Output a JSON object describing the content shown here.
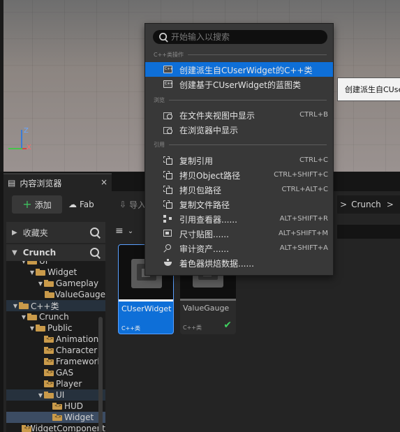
{
  "viewport": {
    "axis": {
      "x": "X",
      "y": "Y",
      "z": "Z"
    }
  },
  "content_browser": {
    "tab_title": "内容浏览器",
    "tab_close": "×",
    "toolbar": {
      "add_label": "添加",
      "fab_label": "Fab",
      "import_label": "导入"
    },
    "breadcrumb": {
      "current": "Crunch",
      "chevron": ">"
    },
    "favorites_label": "收藏夹",
    "root_label": "Crunch",
    "tree": [
      {
        "label": "UI",
        "depth": 2,
        "expanded": true,
        "code": false
      },
      {
        "label": "Widget",
        "depth": 3,
        "expanded": true,
        "code": false
      },
      {
        "label": "Gameplay",
        "depth": 4,
        "expanded": true,
        "code": false
      },
      {
        "label": "ValueGauge",
        "depth": 5,
        "expanded": false,
        "code": false
      },
      {
        "label": "C++类",
        "depth": 1,
        "expanded": true,
        "code": false
      },
      {
        "label": "Crunch",
        "depth": 2,
        "expanded": true,
        "code": false
      },
      {
        "label": "Public",
        "depth": 3,
        "expanded": true,
        "code": false
      },
      {
        "label": "Animation",
        "depth": 4,
        "expanded": false,
        "code": true
      },
      {
        "label": "Character",
        "depth": 4,
        "expanded": false,
        "code": true
      },
      {
        "label": "Framework",
        "depth": 4,
        "expanded": false,
        "code": true
      },
      {
        "label": "GAS",
        "depth": 4,
        "expanded": false,
        "code": true
      },
      {
        "label": "Player",
        "depth": 4,
        "expanded": false,
        "code": true
      },
      {
        "label": "UI",
        "depth": 4,
        "expanded": true,
        "code": false
      },
      {
        "label": "HUD",
        "depth": 5,
        "expanded": false,
        "code": true
      },
      {
        "label": "Widget",
        "depth": 5,
        "expanded": false,
        "code": true
      },
      {
        "label": "WidgetComponent",
        "depth": 5,
        "expanded": false,
        "code": true
      }
    ],
    "assets": [
      {
        "name": "CUserWidget",
        "kind": "C++类",
        "selected": true
      },
      {
        "name": "ValueGauge",
        "kind": "C++类",
        "selected": false
      }
    ]
  },
  "context_menu": {
    "search_placeholder": "开始输入以搜索",
    "sections": {
      "cpp": "C++类操作",
      "browse": "浏览",
      "reference": "引用"
    },
    "items": {
      "create_derived_cpp": {
        "label": "创建派生自CUserWidget的C++类",
        "shortcut": "",
        "icon": "cpp-class-icon"
      },
      "create_blueprint": {
        "label": "创建基于CUserWidget的蓝图类",
        "shortcut": "",
        "icon": "blueprint-class-icon"
      },
      "show_in_folder": {
        "label": "在文件夹视图中显示",
        "shortcut": "CTRL+B",
        "icon": "folder-search-icon"
      },
      "show_in_browser": {
        "label": "在浏览器中显示",
        "shortcut": "",
        "icon": "folder-search-icon"
      },
      "copy_reference": {
        "label": "复制引用",
        "shortcut": "CTRL+C",
        "icon": "copy-icon"
      },
      "copy_object_path": {
        "label": "拷贝Object路径",
        "shortcut": "CTRL+SHIFT+C",
        "icon": "copy-icon"
      },
      "copy_package_path": {
        "label": "拷贝包路径",
        "shortcut": "CTRL+ALT+C",
        "icon": "copy-icon"
      },
      "copy_file_path": {
        "label": "复制文件路径",
        "shortcut": "",
        "icon": "copy-icon"
      },
      "reference_viewer": {
        "label": "引用查看器......",
        "shortcut": "ALT+SHIFT+R",
        "icon": "reference-viewer-icon"
      },
      "size_map": {
        "label": "尺寸贴图......",
        "shortcut": "ALT+SHIFT+M",
        "icon": "size-map-icon"
      },
      "audit_assets": {
        "label": "审计资产......",
        "shortcut": "ALT+SHIFT+A",
        "icon": "audit-icon"
      },
      "shader_cook": {
        "label": "着色器烘焙数据......",
        "shortcut": "",
        "icon": "shader-icon"
      }
    }
  },
  "tooltip": {
    "text": "创建派生自CUserWidget的C++类"
  },
  "colors": {
    "accent": "#0e6fd8",
    "folder": "#c99a4a",
    "check": "#3fcf5f"
  }
}
